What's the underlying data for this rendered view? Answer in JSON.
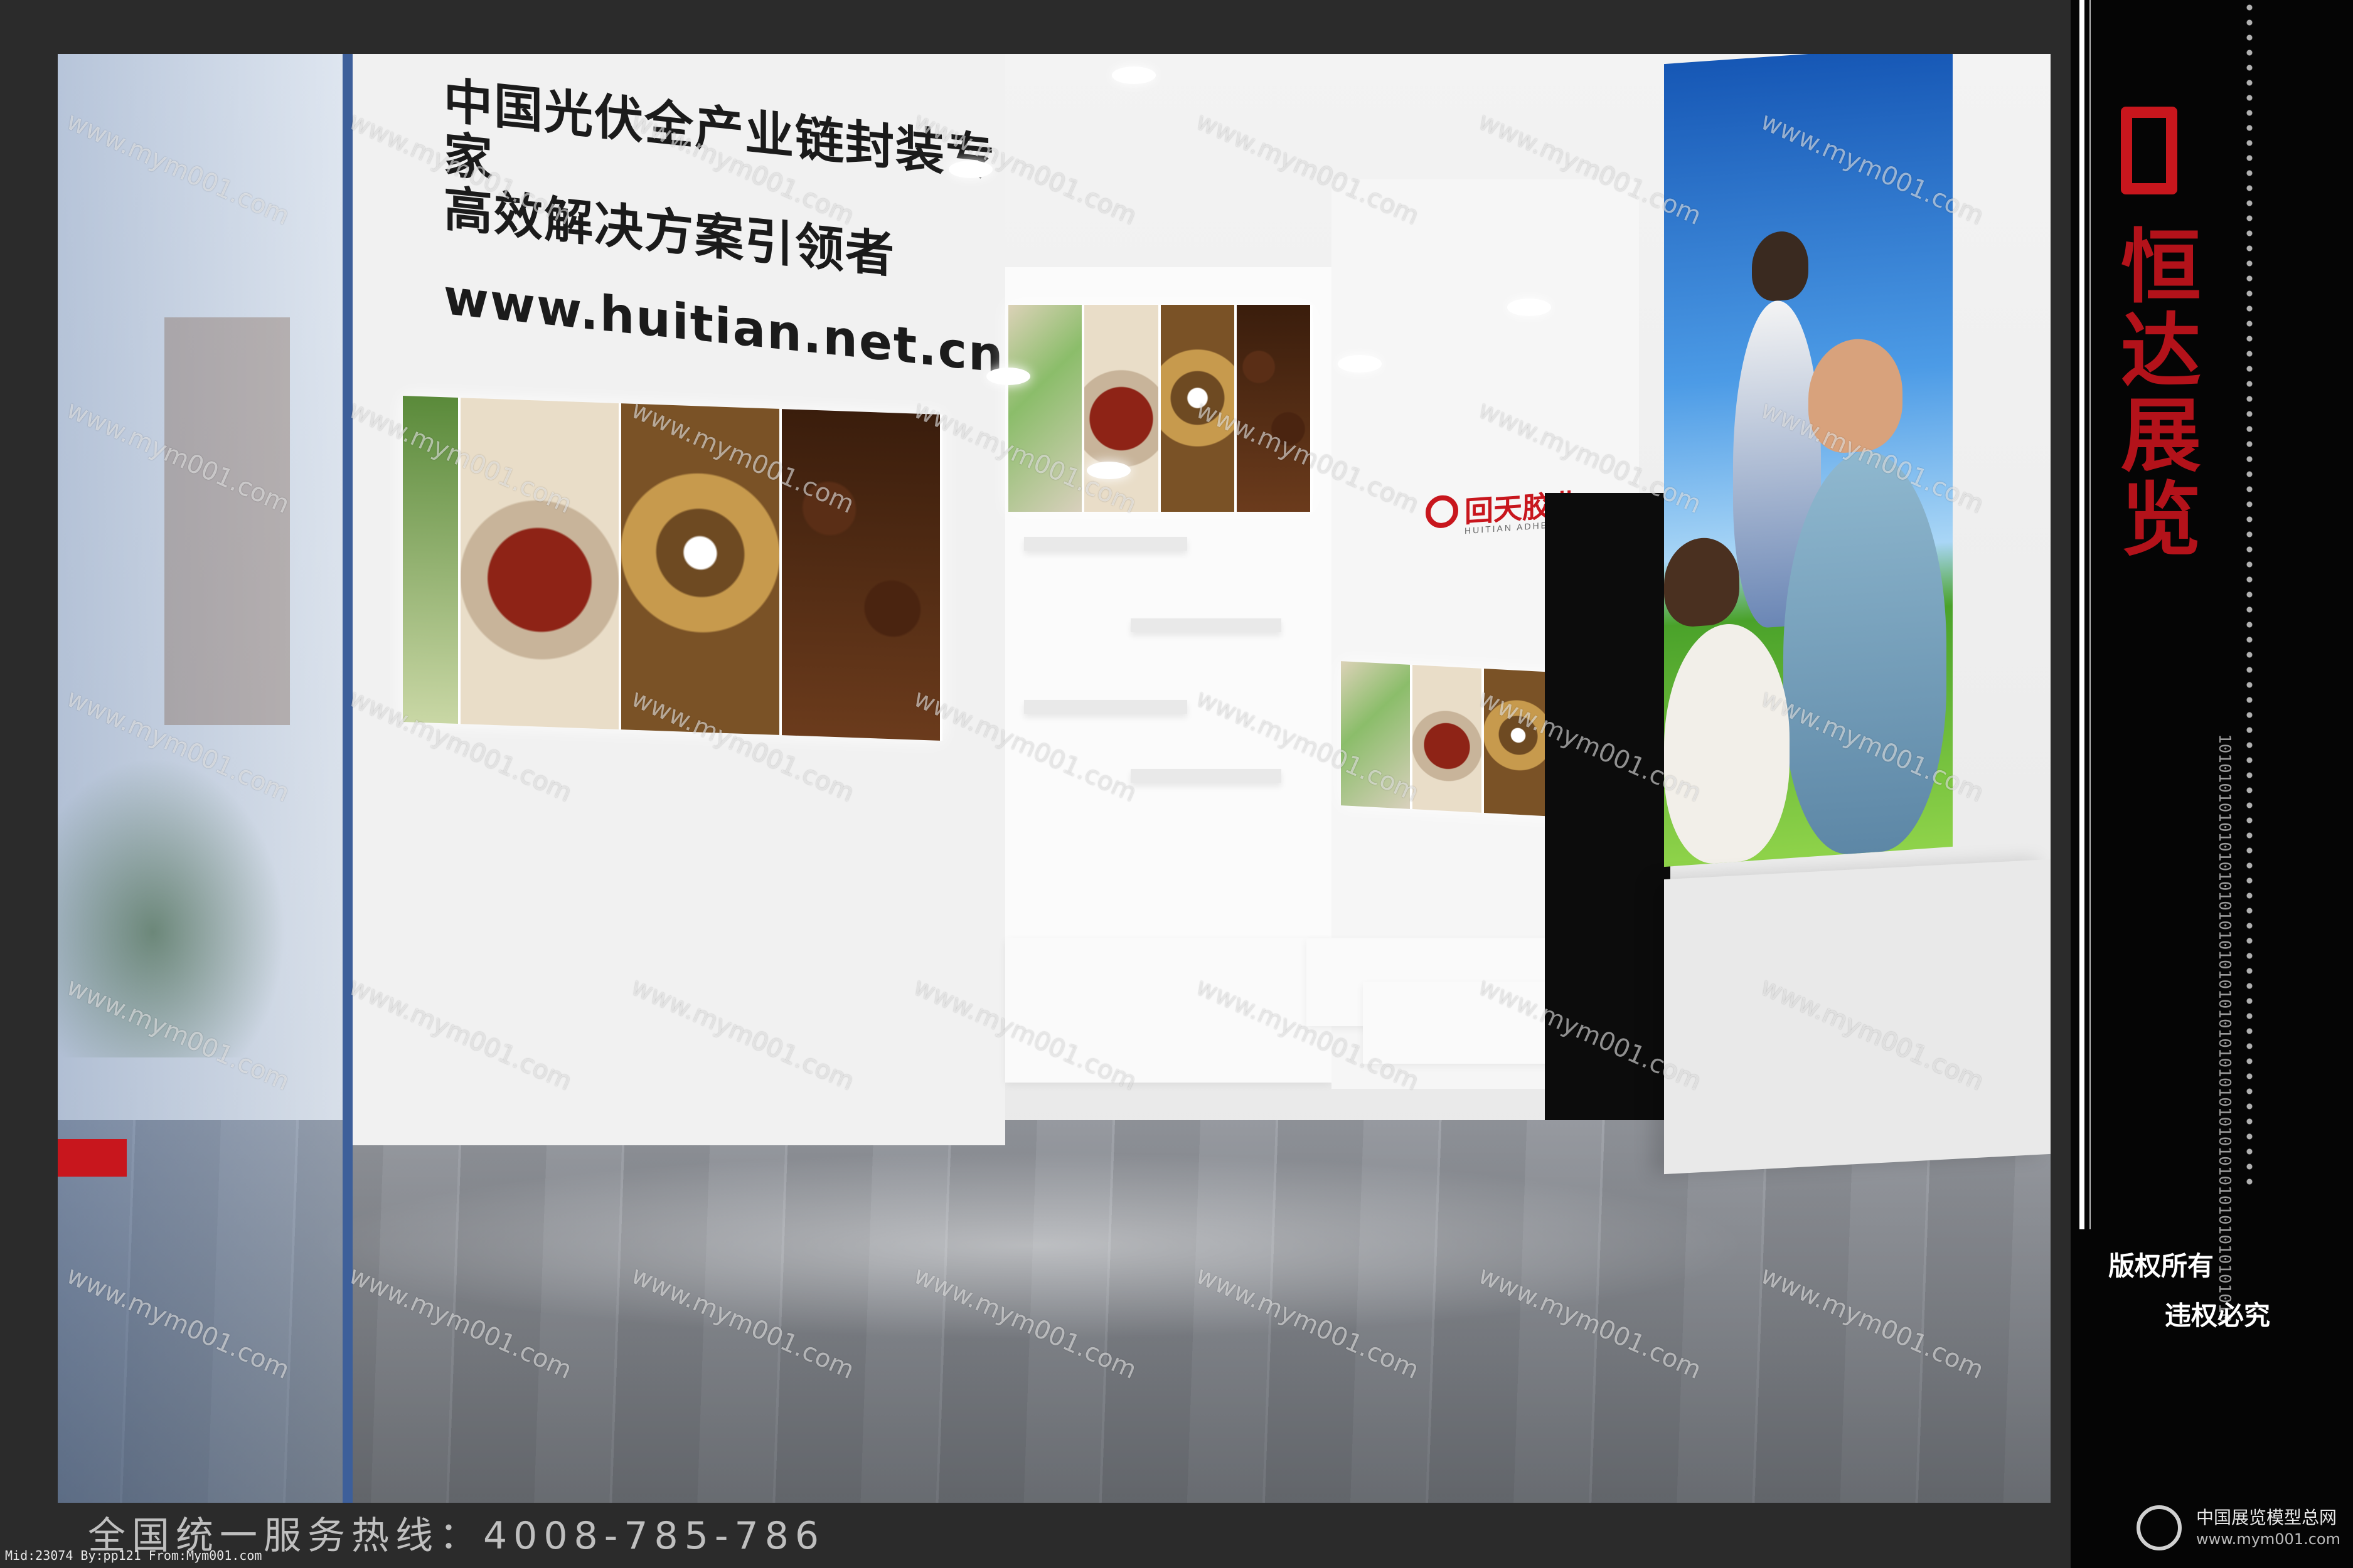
{
  "scene": {
    "slogan_line1": "中国光伏全产业链封装专家",
    "slogan_line2": "高效解决方案引领者",
    "website": "www.huitian.net.cn",
    "company_logo_cn": "回天胶业",
    "company_logo_en": "HUITIAN ADHESIVE",
    "watermark": "www.mym001.com"
  },
  "sidebar": {
    "brand": [
      "恒",
      "达",
      "展",
      "览"
    ],
    "copyright_line1": "版权所有",
    "copyright_line2": "违权必究",
    "binary": "101010101010101010101010101010101010101010101010101010101010",
    "footer_brand": "中国展览模型总网",
    "footer_url": "www.mym001.com"
  },
  "bottom": {
    "hotline": "全国统一服务热线：4008-785-786",
    "meta": "Mid:23074 By:pp121 From:Mym001.com"
  },
  "colors": {
    "brand_red": "#c8161d",
    "background": "#2b2b2b",
    "strip": "#050505"
  }
}
